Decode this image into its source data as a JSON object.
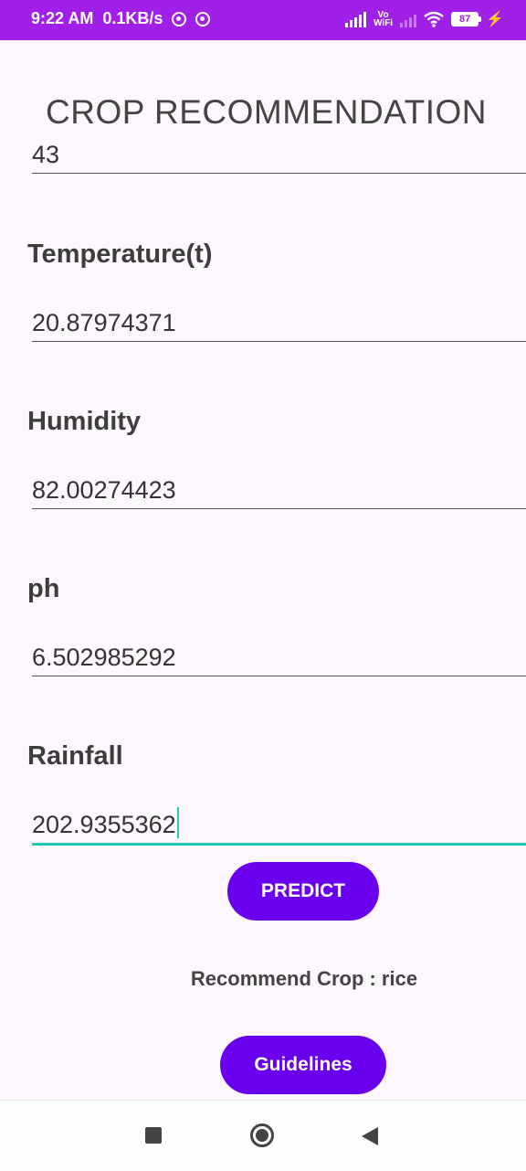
{
  "status_bar": {
    "time": "9:22 AM",
    "speed": "0.1KB/s",
    "vowifi_top": "Vo",
    "vowifi_bottom": "WiFi",
    "battery": "87"
  },
  "app": {
    "title": "CROP RECOMMENDATION"
  },
  "form": {
    "top_field_value": "43",
    "temperature": {
      "label": "Temperature(t)",
      "value": "20.87974371"
    },
    "humidity": {
      "label": "Humidity",
      "value": "82.00274423"
    },
    "ph": {
      "label": "ph",
      "value": "6.502985292"
    },
    "rainfall": {
      "label": "Rainfall",
      "value": "202.9355362"
    }
  },
  "actions": {
    "predict_label": "PREDICT",
    "guidelines_label": "Guidelines"
  },
  "result": {
    "text": "Recommend Crop : rice"
  },
  "colors": {
    "status_bar": "#a020e8",
    "button": "#6a00ee",
    "accent_underline": "#23c8b6",
    "background": "#fdf7fd"
  },
  "icons": {
    "nav_recents": "square-icon",
    "nav_home": "circle-icon",
    "nav_back": "triangle-back-icon"
  }
}
